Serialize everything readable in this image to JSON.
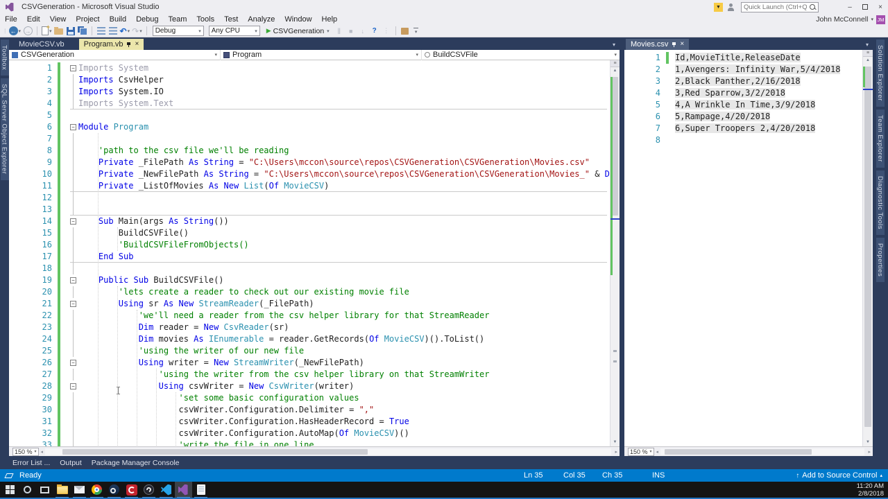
{
  "window": {
    "title": "CSVGeneration - Microsoft Visual Studio",
    "quick_launch_placeholder": "Quick Launch (Ctrl+Q)",
    "user": "John McConnell",
    "user_initials": "JM",
    "minimize": "–",
    "close": "×"
  },
  "menu": [
    "File",
    "Edit",
    "View",
    "Project",
    "Build",
    "Debug",
    "Team",
    "Tools",
    "Test",
    "Analyze",
    "Window",
    "Help"
  ],
  "toolbar": {
    "configuration": "Debug",
    "platform": "Any CPU",
    "start_label": "CSVGeneration"
  },
  "glyphs": {
    "back": "←",
    "forward": "→",
    "undo": "↶",
    "redo": "↷",
    "caret": "▾",
    "play": "▶",
    "pause": "‖",
    "stop": "■",
    "step1": "↓",
    "step2": "↳",
    "question": "?",
    "dots": "⋮",
    "funnel": "▼",
    "up": "▲",
    "down": "▼",
    "left": "◂",
    "right": "▸",
    "split": "≡",
    "tri_up": "▴",
    "up_arrow": "↑"
  },
  "left_tabs": [
    "Toolbox",
    "SQL Server Object Explorer"
  ],
  "right_tabs": [
    "Solution Explorer",
    "Team Explorer",
    "Diagnostic Tools",
    "Properties"
  ],
  "editor": {
    "tabs": [
      {
        "label": "MovieCSV.vb"
      },
      {
        "label": "Program.vb"
      }
    ],
    "breadcrumb": [
      "CSVGeneration",
      "Program",
      "BuildCSVFile"
    ],
    "zoom": "150 %",
    "lines": [
      {
        "n": 1,
        "f": 1,
        "s": [
          [
            "g",
            "Imports System"
          ]
        ]
      },
      {
        "n": 2,
        "g": 1,
        "s": [
          [
            "k",
            "Imports"
          ],
          [
            "n",
            " CsvHelper"
          ]
        ]
      },
      {
        "n": 3,
        "g": 1,
        "s": [
          [
            "k",
            "Imports"
          ],
          [
            "n",
            " System.IO"
          ]
        ]
      },
      {
        "n": 4,
        "g": 1,
        "p": 1,
        "s": [
          [
            "g",
            "Imports System.Text"
          ]
        ]
      },
      {
        "n": 5,
        "s": []
      },
      {
        "n": 6,
        "f": 1,
        "s": [
          [
            "k",
            "Module"
          ],
          [
            "n",
            " "
          ],
          [
            "t",
            "Program"
          ]
        ]
      },
      {
        "n": 7,
        "g": 1,
        "s": []
      },
      {
        "n": 8,
        "g": 1,
        "s": [
          [
            "c",
            "    'path to the csv file we'll be reading"
          ]
        ]
      },
      {
        "n": 9,
        "g": 1,
        "s": [
          [
            "k",
            "    Private"
          ],
          [
            "n",
            " _FilePath "
          ],
          [
            "k",
            "As"
          ],
          [
            "n",
            " "
          ],
          [
            "k",
            "String"
          ],
          [
            "n",
            " = "
          ],
          [
            "s",
            "\"C:\\Users\\mccon\\source\\repos\\CSVGeneration\\CSVGeneration\\Movies.csv\""
          ]
        ]
      },
      {
        "n": 10,
        "g": 1,
        "s": [
          [
            "k",
            "    Private"
          ],
          [
            "n",
            " _NewFilePath "
          ],
          [
            "k",
            "As"
          ],
          [
            "n",
            " "
          ],
          [
            "k",
            "String"
          ],
          [
            "n",
            " = "
          ],
          [
            "s",
            "\"C:\\Users\\mccon\\source\\repos\\CSVGeneration\\CSVGeneration\\Movies_\""
          ],
          [
            "n",
            " & "
          ],
          [
            "k",
            "Da"
          ]
        ]
      },
      {
        "n": 11,
        "g": 1,
        "p": 1,
        "s": [
          [
            "k",
            "    Private"
          ],
          [
            "n",
            " _ListOfMovies "
          ],
          [
            "k",
            "As"
          ],
          [
            "n",
            " "
          ],
          [
            "k",
            "New"
          ],
          [
            "n",
            " "
          ],
          [
            "t",
            "List"
          ],
          [
            "n",
            "("
          ],
          [
            "k",
            "Of"
          ],
          [
            "n",
            " "
          ],
          [
            "t",
            "MovieCSV"
          ],
          [
            "n",
            ")"
          ]
        ]
      },
      {
        "n": 12,
        "g": 1,
        "s": []
      },
      {
        "n": 13,
        "g": 1,
        "p": 1,
        "s": []
      },
      {
        "n": 14,
        "f": 1,
        "s": [
          [
            "k",
            "    Sub"
          ],
          [
            "n",
            " Main(args "
          ],
          [
            "k",
            "As"
          ],
          [
            "n",
            " "
          ],
          [
            "k",
            "String"
          ],
          [
            "n",
            "())"
          ]
        ]
      },
      {
        "n": 15,
        "g": 1,
        "s": [
          [
            "n",
            "        BuildCSVFile()"
          ]
        ]
      },
      {
        "n": 16,
        "g": 1,
        "s": [
          [
            "c",
            "        'BuildCSVFileFromObjects()"
          ]
        ]
      },
      {
        "n": 17,
        "g": 1,
        "p": 1,
        "s": [
          [
            "k",
            "    End Sub"
          ]
        ]
      },
      {
        "n": 18,
        "g": 1,
        "s": []
      },
      {
        "n": 19,
        "f": 1,
        "s": [
          [
            "k",
            "    Public Sub"
          ],
          [
            "n",
            " BuildCSVFile()"
          ]
        ]
      },
      {
        "n": 20,
        "g": 1,
        "s": [
          [
            "c",
            "        'lets create a reader to check out our existing movie file"
          ]
        ]
      },
      {
        "n": 21,
        "f": 1,
        "s": [
          [
            "k",
            "        Using"
          ],
          [
            "n",
            " sr "
          ],
          [
            "k",
            "As"
          ],
          [
            "n",
            " "
          ],
          [
            "k",
            "New"
          ],
          [
            "n",
            " "
          ],
          [
            "t",
            "StreamReader"
          ],
          [
            "n",
            "(_FilePath)"
          ]
        ]
      },
      {
        "n": 22,
        "g": 1,
        "s": [
          [
            "c",
            "            'we'll need a reader from the csv helper library for that StreamReader"
          ]
        ]
      },
      {
        "n": 23,
        "g": 1,
        "s": [
          [
            "k",
            "            Dim"
          ],
          [
            "n",
            " reader = "
          ],
          [
            "k",
            "New"
          ],
          [
            "n",
            " "
          ],
          [
            "t",
            "CsvReader"
          ],
          [
            "n",
            "(sr)"
          ]
        ]
      },
      {
        "n": 24,
        "g": 1,
        "s": [
          [
            "k",
            "            Dim"
          ],
          [
            "n",
            " movies "
          ],
          [
            "k",
            "As"
          ],
          [
            "n",
            " "
          ],
          [
            "t",
            "IEnumerable"
          ],
          [
            "n",
            " = reader.GetRecords("
          ],
          [
            "k",
            "Of"
          ],
          [
            "n",
            " "
          ],
          [
            "t",
            "MovieCSV"
          ],
          [
            "n",
            ")().ToList()"
          ]
        ]
      },
      {
        "n": 25,
        "g": 1,
        "s": [
          [
            "c",
            "            'using the writer of our new file"
          ]
        ]
      },
      {
        "n": 26,
        "f": 1,
        "s": [
          [
            "k",
            "            Using"
          ],
          [
            "n",
            " writer = "
          ],
          [
            "k",
            "New"
          ],
          [
            "n",
            " "
          ],
          [
            "t",
            "StreamWriter"
          ],
          [
            "n",
            "(_NewFilePath)"
          ]
        ]
      },
      {
        "n": 27,
        "g": 1,
        "s": [
          [
            "c",
            "                'using the writer from the csv helper library on that StreamWriter"
          ]
        ]
      },
      {
        "n": 28,
        "f": 1,
        "s": [
          [
            "k",
            "                Using"
          ],
          [
            "n",
            " csvWriter = "
          ],
          [
            "k",
            "New"
          ],
          [
            "t",
            " CsvWriter"
          ],
          [
            "n",
            "(writer)"
          ]
        ]
      },
      {
        "n": 29,
        "g": 1,
        "s": [
          [
            "c",
            "                    'set some basic configuration values"
          ]
        ]
      },
      {
        "n": 30,
        "g": 1,
        "s": [
          [
            "n",
            "                    csvWriter.Configuration.Delimiter = "
          ],
          [
            "s",
            "\",\""
          ]
        ]
      },
      {
        "n": 31,
        "g": 1,
        "s": [
          [
            "n",
            "                    csvWriter.Configuration.HasHeaderRecord = "
          ],
          [
            "k",
            "True"
          ]
        ]
      },
      {
        "n": 32,
        "g": 1,
        "s": [
          [
            "n",
            "                    csvWriter.Configuration.AutoMap("
          ],
          [
            "k",
            "Of"
          ],
          [
            "n",
            " "
          ],
          [
            "t",
            "MovieCSV"
          ],
          [
            "n",
            ")()"
          ]
        ]
      },
      {
        "n": 33,
        "g": 1,
        "s": [
          [
            "c",
            "                    'write the file in one line"
          ]
        ]
      }
    ]
  },
  "csv": {
    "tab": "Movies.csv",
    "zoom": "150 %",
    "changed": [
      1
    ],
    "lines": [
      "Id,MovieTitle,ReleaseDate",
      "1,Avengers: Infinity War,5/4/2018",
      "2,Black Panther,2/16/2018",
      "3,Red Sparrow,3/2/2018",
      "4,A Wrinkle In Time,3/9/2018",
      "5,Rampage,4/20/2018",
      "6,Super Troopers 2,4/20/2018",
      ""
    ]
  },
  "dock_tabs": [
    "Error List ...",
    "Output",
    "Package Manager Console"
  ],
  "status": {
    "ready": "Ready",
    "ln": "Ln 35",
    "col": "Col 35",
    "ch": "Ch 35",
    "ins": "INS",
    "source_control": "Add to Source Control"
  },
  "taskbar": {
    "time": "11:20 AM",
    "date": "2/8/2018",
    "icons": [
      {
        "id": "start",
        "run": false
      },
      {
        "id": "search",
        "run": false
      },
      {
        "id": "task-view",
        "run": false
      },
      {
        "id": "file-explorer",
        "run": true
      },
      {
        "id": "mail",
        "run": true
      },
      {
        "id": "chrome",
        "run": true
      },
      {
        "id": "steam",
        "run": true
      },
      {
        "id": "screen-recorder",
        "run": true
      },
      {
        "id": "obs-studio",
        "run": true
      },
      {
        "id": "vscode",
        "run": true
      },
      {
        "id": "visual-studio",
        "run": true,
        "active": true
      },
      {
        "id": "notepad",
        "run": true
      }
    ]
  },
  "colors": {
    "accent": "#007acc",
    "env_background": "#2c3c5c",
    "active_tab": "#ebe6ab",
    "keyword": "#0000e6",
    "type": "#2b91af",
    "string": "#a31515",
    "comment": "#008000",
    "changed_margin": "#62c462"
  }
}
